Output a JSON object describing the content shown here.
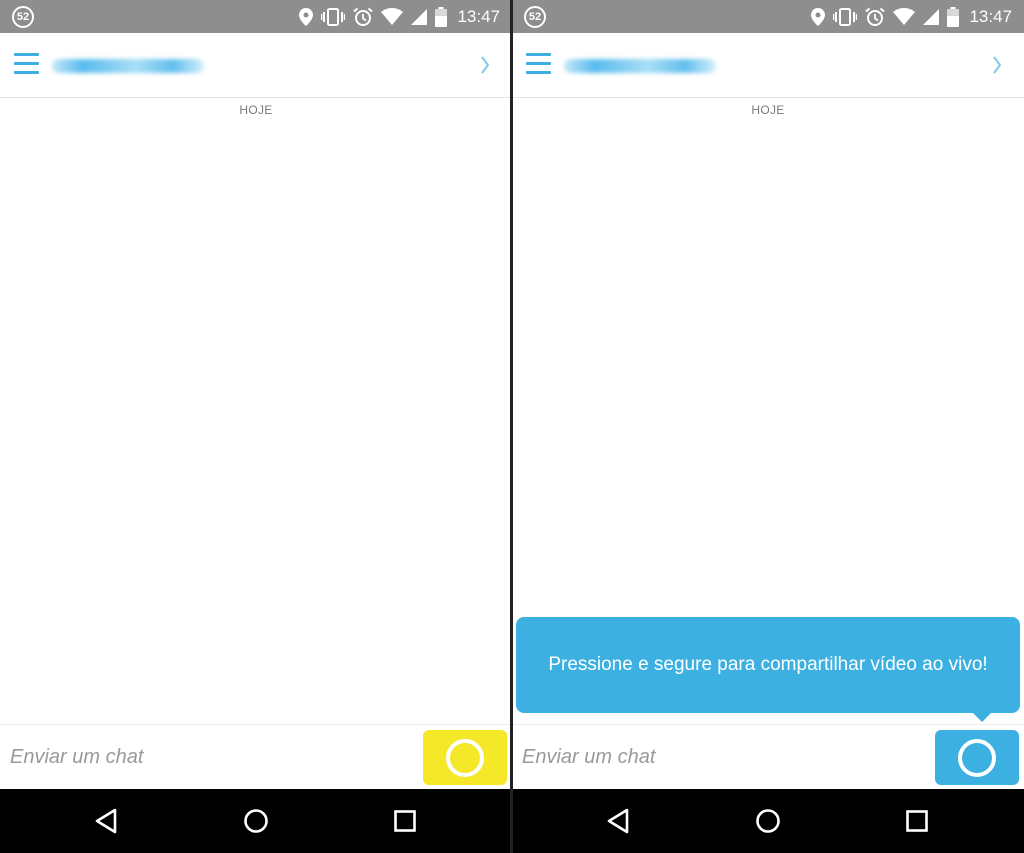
{
  "colors": {
    "accent": "#3daee0",
    "capture_yellow": "#f5e829",
    "capture_blue": "#3db0e2",
    "status_bar": "#8e8e8e"
  },
  "panels": [
    {
      "status": {
        "notification_count": "52",
        "time": "13:47"
      },
      "header": {
        "contact_name": "••••••••••••••"
      },
      "date_label": "HOJE",
      "tooltip": null,
      "input": {
        "placeholder": "Enviar um chat"
      },
      "capture_button_color": "yellow"
    },
    {
      "status": {
        "notification_count": "52",
        "time": "13:47"
      },
      "header": {
        "contact_name": "••••••••••••••"
      },
      "date_label": "HOJE",
      "tooltip": "Pressione e segure para compartilhar vídeo ao vivo!",
      "input": {
        "placeholder": "Enviar um chat"
      },
      "capture_button_color": "blue"
    }
  ],
  "icons": {
    "status": [
      "location-icon",
      "vibrate-icon",
      "alarm-icon",
      "wifi-icon",
      "signal-icon",
      "battery-icon"
    ],
    "navbar": [
      "back-icon",
      "home-icon",
      "recents-icon"
    ]
  }
}
